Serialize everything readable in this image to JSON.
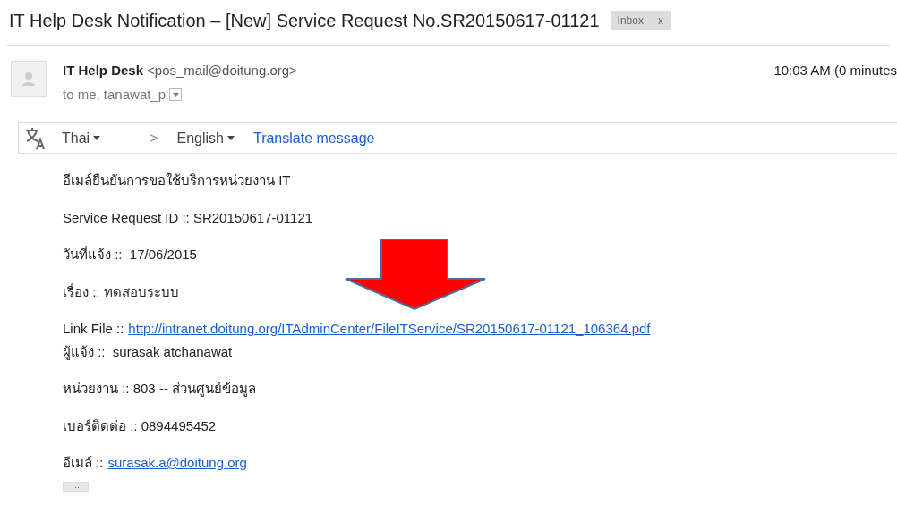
{
  "subject": {
    "title": "IT Help Desk Notification – [New] Service Request No.SR20150617-01121",
    "label": "Inbox",
    "label_close": "x"
  },
  "header": {
    "sender_name": "IT Help Desk",
    "sender_email": "<pos_mail@doitung.org>",
    "recipients": "to me, tanawat_p",
    "time": "10:03 AM (0 minutes"
  },
  "translate_bar": {
    "from": "Thai",
    "separator": ">",
    "to": "English",
    "action": "Translate message"
  },
  "body": [
    [
      {
        "label": "อีเมล์ยืนยันการขอใช้บริการหน่วยงาน IT"
      }
    ],
    [
      {
        "label": "Service Request ID ::",
        "value": "SR20150617-01121"
      }
    ],
    [
      {
        "label": "วันที่แจ้ง ::",
        "value": " 17/06/2015"
      }
    ],
    [
      {
        "label": "เรื่อง ::",
        "value": "ทดสอบระบบ"
      }
    ],
    [
      {
        "label": "Link File ::",
        "link": "http://intranet.doitung.org/ITAdminCenter/FileITService/SR20150617-01121_106364.pdf"
      },
      {
        "label": "ผู้แจ้ง ::",
        "value": " surasak atchanawat"
      }
    ],
    [
      {
        "label": "หน่วยงาน ::",
        "value": "803 -- ส่วนศูนย์ข้อมูล"
      }
    ],
    [
      {
        "label": "เบอร์ติดต่อ ::",
        "value": "0894495452"
      }
    ],
    [
      {
        "label": "อีเมล์ ::",
        "link": " surasak.a@doitung.org"
      }
    ]
  ],
  "more": "···"
}
